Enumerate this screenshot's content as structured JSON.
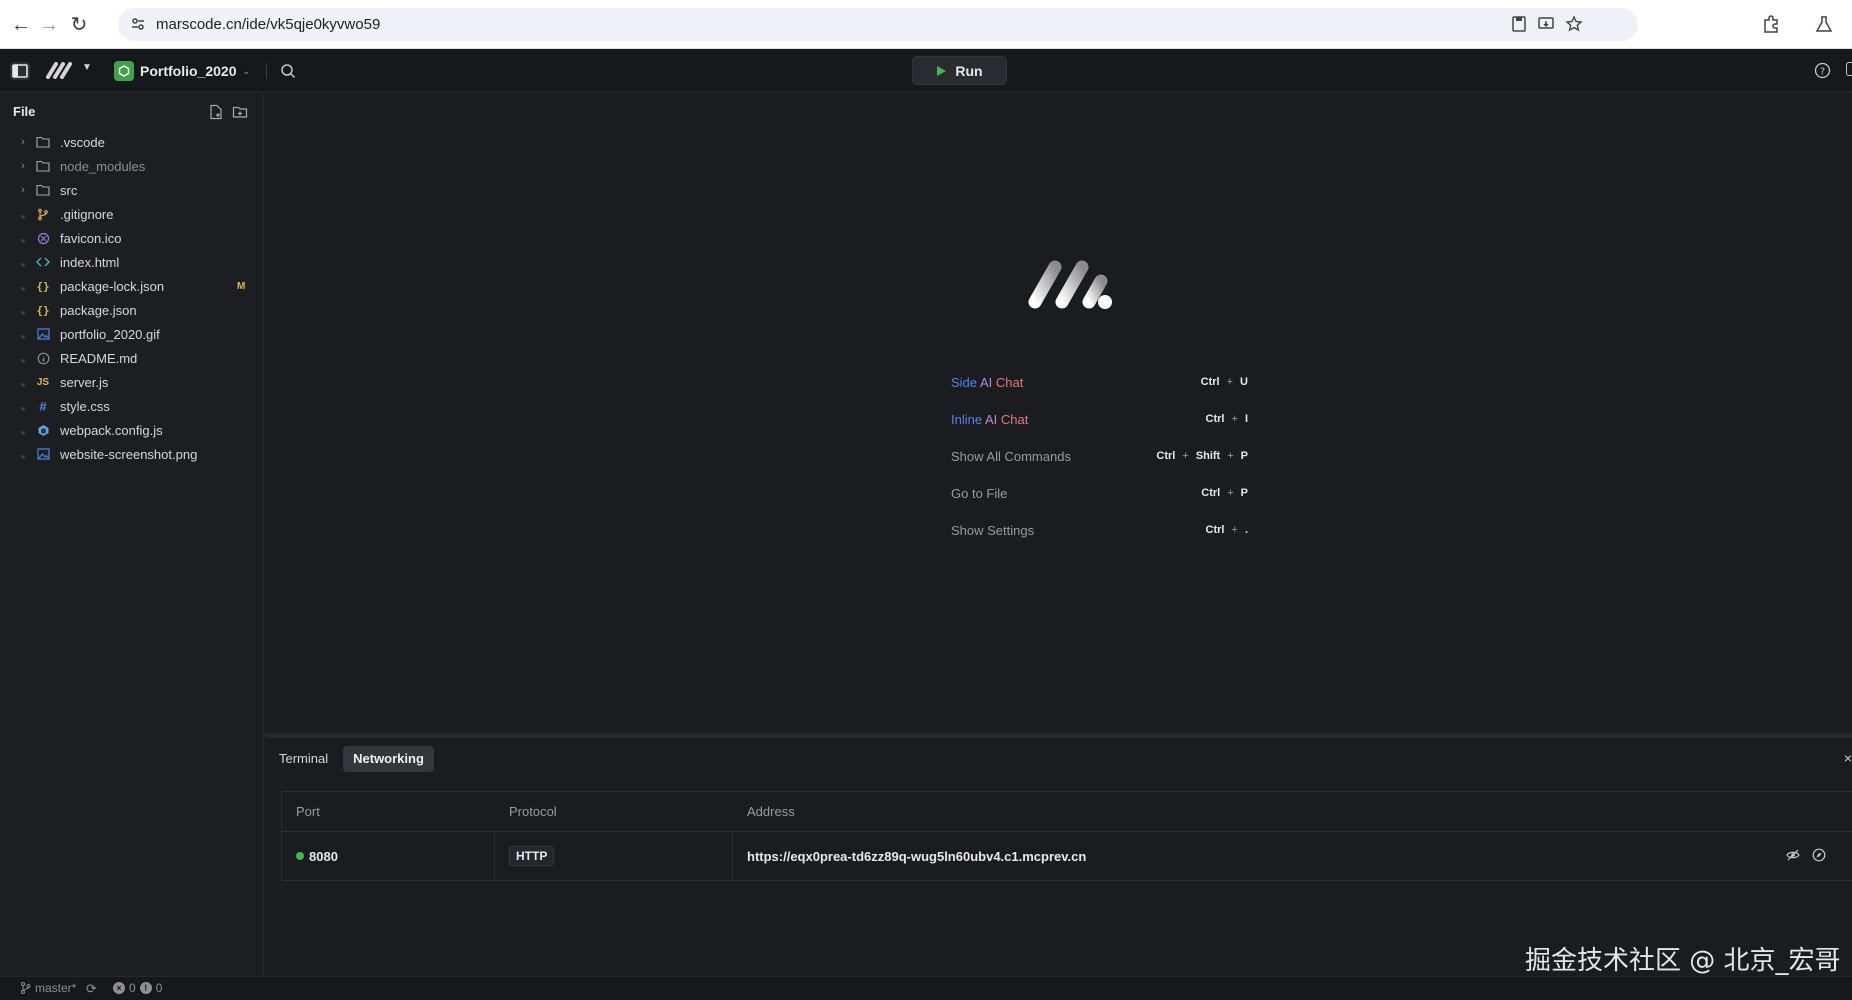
{
  "browser": {
    "url": "marscode.cn/ide/vk5qje0kyvwo59"
  },
  "topbar": {
    "project_name": "Portfolio_2020",
    "run_label": "Run"
  },
  "sidebar": {
    "title": "File",
    "items": [
      {
        "label": ".vscode",
        "type": "folder",
        "icon": "folder-icon"
      },
      {
        "label": "node_modules",
        "type": "folder",
        "icon": "folder-icon",
        "dim": true
      },
      {
        "label": "src",
        "type": "folder",
        "icon": "folder-icon"
      },
      {
        "label": ".gitignore",
        "type": "file",
        "icon": "git-icon",
        "icon_color": "#d6b94a"
      },
      {
        "label": "favicon.ico",
        "type": "file",
        "icon": "favicon-icon",
        "icon_color": "#9c7bd8"
      },
      {
        "label": "index.html",
        "type": "file",
        "icon": "html-icon",
        "icon_color": "#3fb9a8"
      },
      {
        "label": "package-lock.json",
        "type": "file",
        "icon": "json-icon",
        "icon_color": "#d6b94a",
        "status": "M"
      },
      {
        "label": "package.json",
        "type": "file",
        "icon": "json-icon",
        "icon_color": "#d6b94a"
      },
      {
        "label": "portfolio_2020.gif",
        "type": "file",
        "icon": "image-icon",
        "icon_color": "#4f86e8"
      },
      {
        "label": "README.md",
        "type": "file",
        "icon": "info-icon",
        "icon_color": "#8e8e94"
      },
      {
        "label": "server.js",
        "type": "file",
        "icon": "js-icon",
        "icon_color": "#d6b94a"
      },
      {
        "label": "style.css",
        "type": "file",
        "icon": "css-icon",
        "icon_color": "#4f86e8"
      },
      {
        "label": "webpack.config.js",
        "type": "file",
        "icon": "webpack-icon",
        "icon_color": "#5aa9e6"
      },
      {
        "label": "website-screenshot.png",
        "type": "file",
        "icon": "image-icon",
        "icon_color": "#4f86e8"
      }
    ]
  },
  "welcome": {
    "shortcuts": [
      {
        "label_parts": [
          "Side",
          "AI",
          "Chat"
        ],
        "keys": [
          "Ctrl",
          "+",
          "U"
        ]
      },
      {
        "label_parts": [
          "Inline",
          "AI",
          "Chat"
        ],
        "keys": [
          "Ctrl",
          "+",
          "I"
        ]
      },
      {
        "label": "Show All Commands",
        "keys": [
          "Ctrl",
          "+",
          "Shift",
          "+",
          "P"
        ]
      },
      {
        "label": "Go to File",
        "keys": [
          "Ctrl",
          "+",
          "P"
        ]
      },
      {
        "label": "Show Settings",
        "keys": [
          "Ctrl",
          "+",
          "."
        ]
      }
    ]
  },
  "panel": {
    "tabs": [
      "Terminal",
      "Networking"
    ],
    "active_tab": "Networking",
    "close_label": "×",
    "columns": [
      "Port",
      "Protocol",
      "Address"
    ],
    "rows": [
      {
        "port": "8080",
        "protocol": "HTTP",
        "address": "https://eqx0prea-td6zz89q-wug5ln60ubv4.c1.mcprev.cn"
      }
    ]
  },
  "status": {
    "branch": "master*",
    "errors": "0",
    "warnings": "0"
  },
  "watermark": "掘金技术社区 @ 北京_宏哥",
  "colors": {
    "accent_green": "#3fa34d",
    "port_dot": "#3fb950",
    "ai_blue": "#4f86e8",
    "ai_pink": "#e07a82",
    "ai_purple": "#b48ad8"
  }
}
